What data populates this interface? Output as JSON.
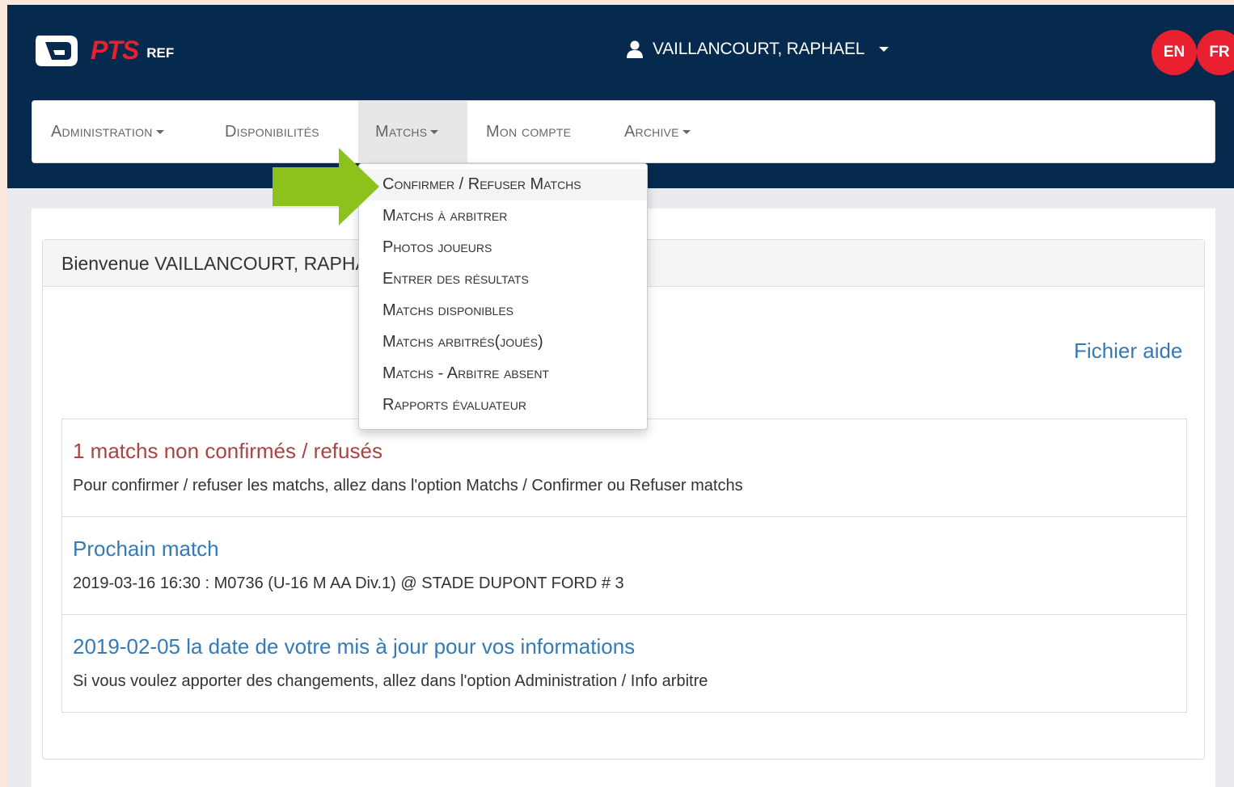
{
  "header": {
    "brand": "PTS",
    "brand_sub": "REF",
    "user_name": "VAILLANCOURT, RAPHAEL",
    "languages": [
      "EN",
      "FR"
    ]
  },
  "nav": {
    "items": [
      {
        "label": "Administration",
        "has_caret": true
      },
      {
        "label": "Disponibilités",
        "has_caret": false
      },
      {
        "label": "Matchs",
        "has_caret": true,
        "active": true
      },
      {
        "label": "Mon compte",
        "has_caret": false
      },
      {
        "label": "Archive",
        "has_caret": true
      }
    ]
  },
  "matchs_menu": {
    "items": [
      "Confirmer / Refuser Matchs",
      "Matchs à arbitrer",
      "Photos joueurs",
      "Entrer des résultats",
      "Matchs disponibles",
      "Matchs arbitrés(joués)",
      "Matchs - Arbitre absent",
      "Rapports évaluateur"
    ]
  },
  "panel": {
    "welcome": "Bienvenue VAILLANCOURT, RAPHAEL",
    "help_link": "Fichier aide"
  },
  "notices": [
    {
      "title": "1 matchs non confirmés / refusés",
      "text": "Pour confirmer / refuser les matchs, allez dans l'option Matchs / Confirmer ou Refuser matchs"
    },
    {
      "title": "Prochain match",
      "text": "2019-03-16 16:30 : M0736 (U-16 M AA Div.1) @ STADE DUPONT FORD # 3"
    },
    {
      "title": "2019-02-05 la date de votre mis à jour pour vos informations",
      "text": "Si vous voulez apporter des changements, allez dans l'option Administration / Info arbitre"
    }
  ],
  "colors": {
    "topbar": "#052a4e",
    "brand_red": "#e8202f",
    "link_blue": "#337ab7",
    "alert_red": "#a94442",
    "arrow_green": "#8dc11c"
  }
}
